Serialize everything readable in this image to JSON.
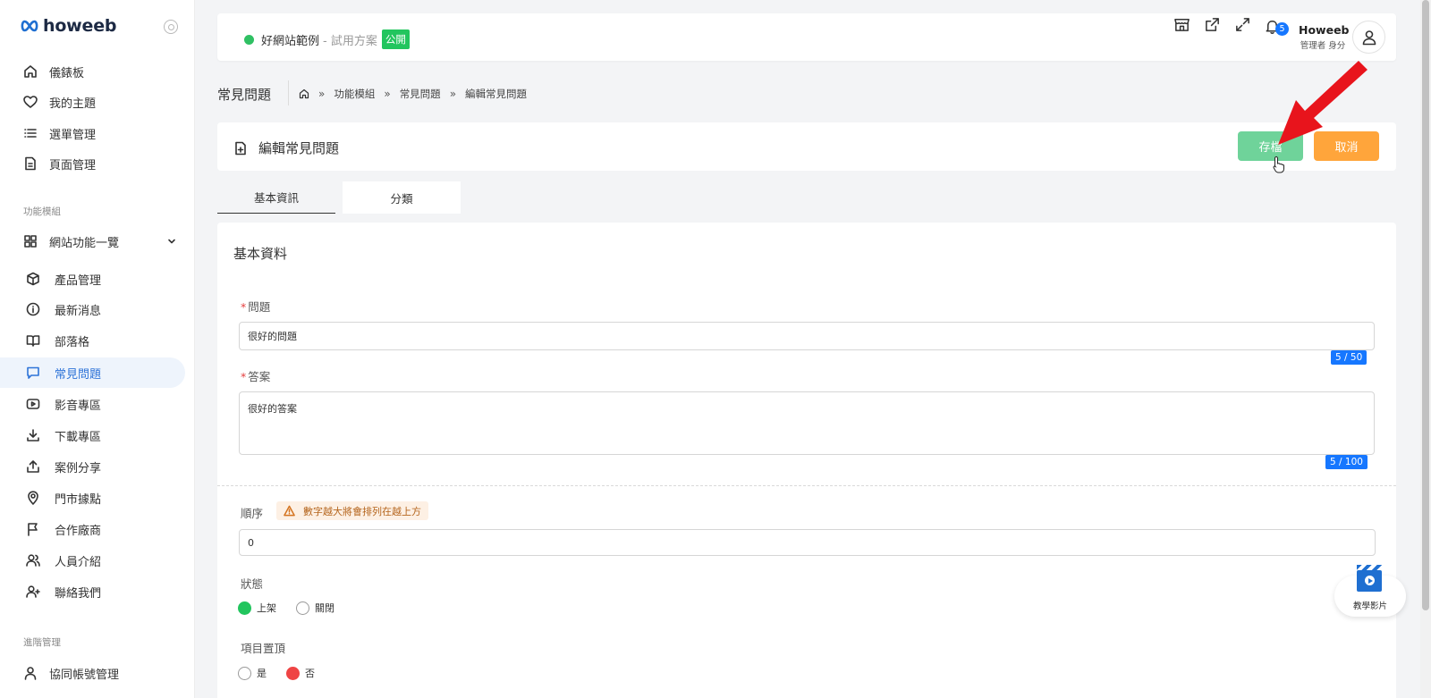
{
  "brand": {
    "logo_text": "howeeb"
  },
  "sidebar": {
    "items": [
      {
        "label": "儀錶板",
        "icon": "home-icon"
      },
      {
        "label": "我的主題",
        "icon": "heart-icon"
      },
      {
        "label": "選單管理",
        "icon": "list-icon"
      },
      {
        "label": "頁面管理",
        "icon": "file-icon"
      }
    ],
    "section_modules": "功能模組",
    "group_label": "網站功能一覽",
    "module_items": [
      {
        "label": "產品管理",
        "icon": "box-icon"
      },
      {
        "label": "最新消息",
        "icon": "info-icon"
      },
      {
        "label": "部落格",
        "icon": "book-icon"
      },
      {
        "label": "常見問題",
        "icon": "chat-icon",
        "active": true
      },
      {
        "label": "影音專區",
        "icon": "video-icon"
      },
      {
        "label": "下載專區",
        "icon": "download-icon"
      },
      {
        "label": "案例分享",
        "icon": "share-icon"
      },
      {
        "label": "門市據點",
        "icon": "map-pin-icon"
      },
      {
        "label": "合作廠商",
        "icon": "flag-icon"
      },
      {
        "label": "人員介紹",
        "icon": "users-icon"
      },
      {
        "label": "聯絡我們",
        "icon": "user-plus-icon"
      }
    ],
    "section_advanced": "進階管理",
    "advanced_items": [
      {
        "label": "協同帳號管理",
        "icon": "user-icon"
      }
    ]
  },
  "topbar": {
    "site_name": "好網站範例",
    "plan": "- 試用方案",
    "public_badge": "公開",
    "notification_count": "5",
    "user_name": "Howeeb",
    "user_role": "管理者 身分"
  },
  "header": {
    "page_title": "常見問題",
    "breadcrumb": [
      "功能模組",
      "常見問題",
      "編輯常見問題"
    ]
  },
  "edit": {
    "title": "編輯常見問題",
    "save_label": "存檔",
    "cancel_label": "取消"
  },
  "tabs": [
    {
      "label": "基本資訊",
      "active": true
    },
    {
      "label": "分類",
      "active": false
    }
  ],
  "form": {
    "section_title": "基本資料",
    "question_label": "問題",
    "question_value": "很好的問題",
    "question_counter": "5 / 50",
    "answer_label": "答案",
    "answer_value": "很好的答案",
    "answer_counter": "5 / 100",
    "order_label": "順序",
    "order_hint": "數字越大將會排列在越上方",
    "order_value": "0",
    "status_label": "狀態",
    "status_options": [
      "上架",
      "關閉"
    ],
    "status_selected": "上架",
    "pin_label": "項目置頂",
    "pin_options": [
      "是",
      "否"
    ],
    "pin_selected": "否"
  },
  "video_widget": {
    "label": "教學影片"
  },
  "colors": {
    "accent_blue": "#1677ff",
    "save_green": "#6fd39a",
    "cancel_orange": "#ffa53b",
    "status_green": "#22c55e",
    "pin_red": "#ef4444",
    "annotation_arrow": "#e8141c"
  }
}
